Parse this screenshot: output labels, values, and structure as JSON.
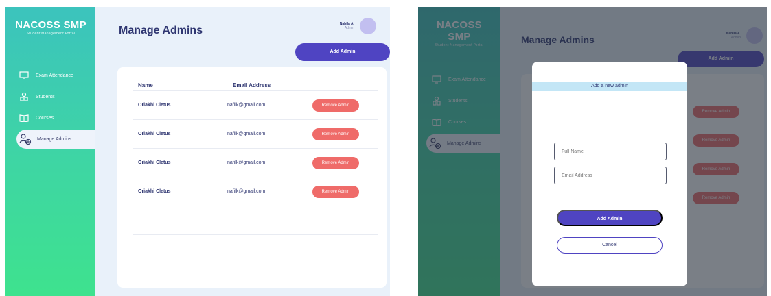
{
  "app": {
    "brand_title": "NACOSS SMP",
    "brand_subtitle": "Student Management Portal"
  },
  "sidebar": {
    "items": [
      {
        "label": "Exam Attendance",
        "icon": "monitor-icon"
      },
      {
        "label": "Students",
        "icon": "students-icon"
      },
      {
        "label": "Courses",
        "icon": "book-icon"
      },
      {
        "label": "Manage Admins",
        "icon": "add-admin-icon",
        "active": true
      }
    ]
  },
  "header": {
    "title": "Manage Admins",
    "user_name": "Nabila A.",
    "user_role": "Admin",
    "add_button": "Add Admin"
  },
  "table": {
    "columns": [
      "Name",
      "Email Address"
    ],
    "rows": [
      {
        "name": "Oriakhi Cletus",
        "email": "nafilk@gmail.com",
        "action": "Remove Admin"
      },
      {
        "name": "Oriakhi Cletus",
        "email": "nafilk@gmail.com",
        "action": "Remove Admin"
      },
      {
        "name": "Oriakhi Cletus",
        "email": "nafilk@gmail.com",
        "action": "Remove Admin"
      },
      {
        "name": "Oriakhi Cletus",
        "email": "nafilk@gmail.com",
        "action": "Remove Admin"
      }
    ]
  },
  "modal": {
    "title": "Add a new admin",
    "full_name_placeholder": "Full Name",
    "email_placeholder": "Email Address",
    "submit_label": "Add Admin",
    "cancel_label": "Cancel"
  },
  "colors": {
    "sidebar_gradient_top": "#3cc3bd",
    "sidebar_gradient_bottom": "#3ee28e",
    "primary": "#4f44c2",
    "danger": "#ef6b69",
    "title": "#2f3671"
  }
}
